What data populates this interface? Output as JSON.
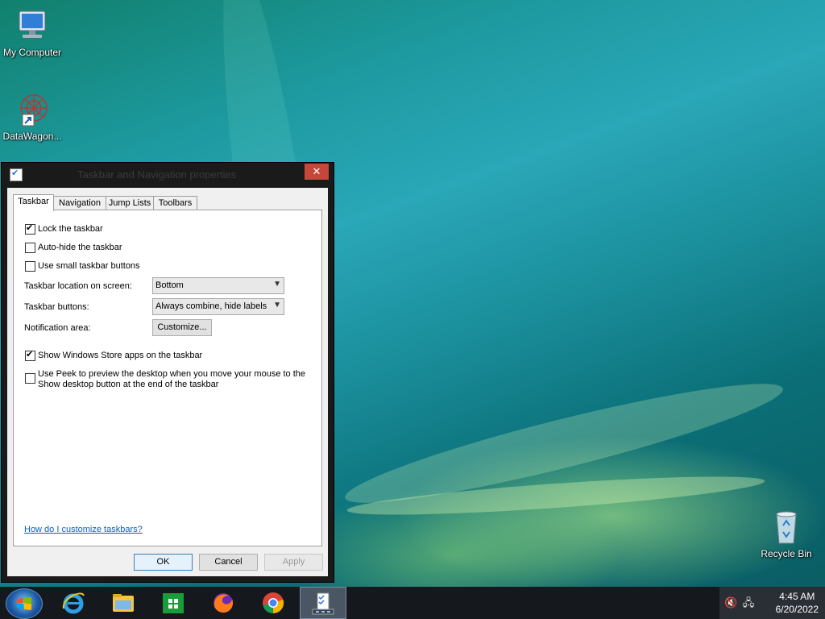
{
  "desktop": {
    "icons": [
      {
        "label": "My Computer"
      },
      {
        "label": "DataWagon..."
      },
      {
        "label": "Recycle Bin"
      }
    ]
  },
  "dialog": {
    "title": "Taskbar and Navigation properties",
    "close_label": "✕",
    "tabs": [
      {
        "label": "Taskbar",
        "active": true
      },
      {
        "label": "Navigation",
        "active": false
      },
      {
        "label": "Jump Lists",
        "active": false
      },
      {
        "label": "Toolbars",
        "active": false
      }
    ],
    "options": {
      "lock_taskbar": {
        "label": "Lock the taskbar",
        "checked": true
      },
      "auto_hide": {
        "label": "Auto-hide the taskbar",
        "checked": false
      },
      "small_buttons": {
        "label": "Use small taskbar buttons",
        "checked": false
      },
      "store_apps": {
        "label": "Show Windows Store apps on the taskbar",
        "checked": true
      },
      "peek": {
        "label_line1": "Use Peek to preview the desktop when you move your mouse to the",
        "label_line2": "Show desktop button at the end of the taskbar",
        "checked": false
      }
    },
    "location": {
      "label": "Taskbar location on screen:",
      "value": "Bottom"
    },
    "buttons_combine": {
      "label": "Taskbar buttons:",
      "value": "Always combine, hide labels"
    },
    "notification": {
      "label": "Notification area:",
      "button": "Customize..."
    },
    "help_link": "How do I customize taskbars?",
    "footer": {
      "ok": "OK",
      "cancel": "Cancel",
      "apply": "Apply"
    }
  },
  "taskbar": {
    "apps": [
      {
        "icon": "internet-explorer-icon"
      },
      {
        "icon": "file-explorer-icon"
      },
      {
        "icon": "windows-store-icon"
      },
      {
        "icon": "firefox-icon"
      },
      {
        "icon": "chrome-icon"
      },
      {
        "icon": "taskbar-properties-icon",
        "active": true
      }
    ],
    "clock": {
      "time": "4:45 AM",
      "date": "6/20/2022"
    }
  },
  "colors": {
    "accent": "#3c7fb1",
    "close": "#c7463a",
    "link": "#0b5fba"
  }
}
